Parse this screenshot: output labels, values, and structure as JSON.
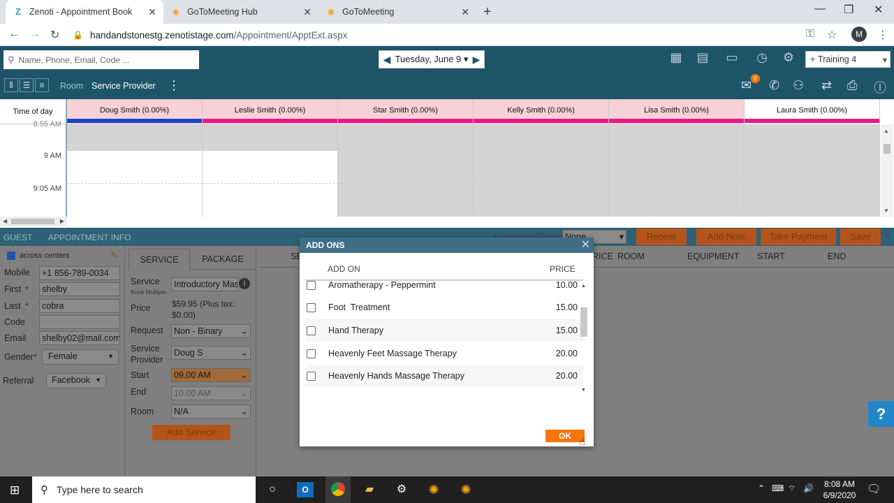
{
  "browser": {
    "tabs": [
      {
        "label": "Zenoti - Appointment Book",
        "icon": "Z"
      },
      {
        "label": "GoToMeeting Hub",
        "icon": "gotomeeting-icon"
      },
      {
        "label": "GoToMeeting",
        "icon": "gotomeeting-icon"
      }
    ],
    "url_host": "handandstonestg.zenotistage.com",
    "url_path": "/Appointment/ApptExt.aspx",
    "profile_initial": "M"
  },
  "header": {
    "search_placeholder": "Name, Phone, Email, Code ...",
    "date": "Tuesday, June 9",
    "location": "Training 4",
    "notification_count": "0"
  },
  "toolbar": {
    "view_room": "Room",
    "view_service_provider": "Service Provider"
  },
  "calendar": {
    "time_header": "Time of day",
    "times": [
      "8:55 AM",
      "9 AM",
      "9:05 AM"
    ],
    "providers": [
      {
        "name": "Doug Smith (0.00%)",
        "color": "#1546c8",
        "head_bg": "#f7d0d8"
      },
      {
        "name": "Leslie Smith (0.00%)",
        "color": "#e8178a",
        "head_bg": "#f7d0d8"
      },
      {
        "name": "Star Smith (0.00%)",
        "color": "#e8178a",
        "head_bg": "#f7d0d8"
      },
      {
        "name": "Kelly Smith (0.00%)",
        "color": "#e8178a",
        "head_bg": "#f7d0d8"
      },
      {
        "name": "Lisa Smith (0.00%)",
        "color": "#e8178a",
        "head_bg": "#f7d0d8"
      },
      {
        "name": "Laura Smith (0.00%)",
        "color": "#e8178a",
        "head_bg": "#ffffff"
      }
    ]
  },
  "lower": {
    "tab_guest": "GUEST",
    "tab_appointment_info": "APPOINTMENT INFO",
    "appointment_category_label": "Appointment Category",
    "appointment_category_value": "None",
    "buttons": [
      "Repeat",
      "Add Note",
      "Take Payment",
      "Save"
    ],
    "across_centers": "across centers",
    "guest": {
      "mobile_label": "Mobile",
      "mobile": "+1 856-789-0034",
      "first_label": "First",
      "first": "shelby",
      "last_label": "Last",
      "last": "cobra",
      "code_label": "Code",
      "code": "",
      "email_label": "Email",
      "email": "shelby02@mail.com",
      "gender_label": "Gender",
      "gender": "Female",
      "referral_label": "Referral",
      "referral": "Facebook"
    },
    "service_tabs": [
      "SERVICE",
      "PACKAGE"
    ],
    "service": {
      "service_label": "Service",
      "book_multiple": "Book Multiple",
      "service_value": "Introductory Mas",
      "price_label": "Price",
      "price_value": "$59.95 (Plus tax: $0.00)",
      "request_label": "Request",
      "request_value": "Non - Binary",
      "provider_label": "Service Provider",
      "provider_value": "Doug S",
      "start_label": "Start",
      "start_value": "09.00 AM",
      "end_label": "End",
      "end_value": "10.00 AM",
      "room_label": "Room",
      "room_value": "N/A",
      "add_service": "Add Service"
    },
    "grid_headers": [
      "SE",
      "RICE",
      "ROOM",
      "EQUIPMENT",
      "START",
      "END"
    ]
  },
  "modal": {
    "title": "ADD ONS",
    "col_addon": "ADD ON",
    "col_price": "PRICE",
    "items": [
      {
        "name": "Aromatherapy - Peppermint",
        "price": "10.00"
      },
      {
        "name": "Foot  Treatment",
        "price": "15.00"
      },
      {
        "name": "Hand Therapy",
        "price": "15.00"
      },
      {
        "name": "Heavenly Feet Massage Therapy",
        "price": "20.00"
      },
      {
        "name": "Heavenly Hands Massage Therapy",
        "price": "20.00"
      }
    ],
    "ok_label": "OK"
  },
  "taskbar": {
    "search_placeholder": "Type here to search",
    "time": "8:08 AM",
    "date": "6/9/2020"
  }
}
